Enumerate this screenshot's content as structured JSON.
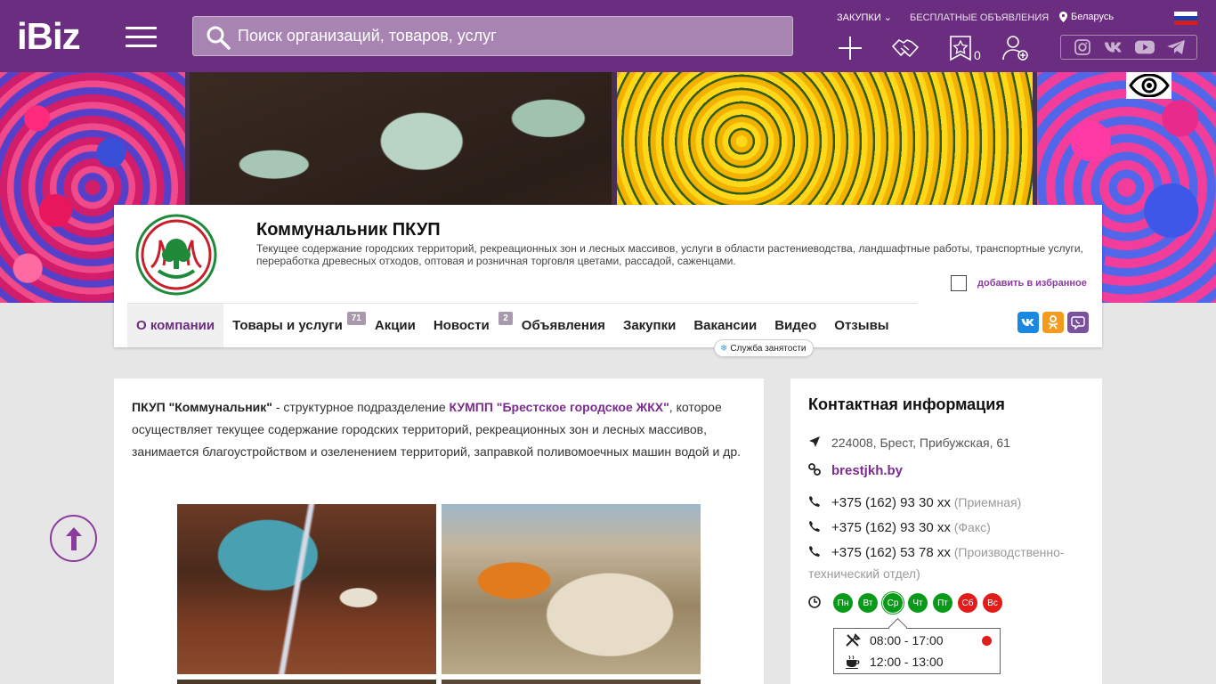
{
  "header": {
    "logo": "iBiz",
    "search_placeholder": "Поиск организаций, товаров, услуг",
    "links": [
      "ЗАКУПКИ",
      "БЕСПЛАТНЫЕ ОБЪЯВЛЕНИЯ"
    ],
    "region": "Беларусь",
    "favorites_count": "0"
  },
  "company": {
    "title": "Коммунальник ПКУП",
    "description": "Текущее содержание городских территорий, рекреационных зон и лесных массивов, услуги в области растениеводства, ландшафтные работы, транспортные услуги, переработка древесных отходов, оптовая и розничная торговля цветами, рассадой, саженцами.",
    "add_favorite": "добавить в избранное",
    "tabs": [
      {
        "label": "О компании",
        "badge": ""
      },
      {
        "label": "Товары и услуги",
        "badge": "71"
      },
      {
        "label": "Акции",
        "badge": ""
      },
      {
        "label": "Новости",
        "badge": "2"
      },
      {
        "label": "Объявления",
        "badge": ""
      },
      {
        "label": "Закупки",
        "badge": ""
      },
      {
        "label": "Вакансии",
        "badge": ""
      },
      {
        "label": "Видео",
        "badge": ""
      },
      {
        "label": "Отзывы",
        "badge": ""
      }
    ],
    "employment_tag": "Служба занятости"
  },
  "about": {
    "name_bold": "ПКУП \"Коммунальник\"",
    "text_1": " - структурное подразделение ",
    "link": "КУМПП \"Брестское городское ЖКХ\"",
    "text_2": ", которое осуществляет текущее содержание городских территорий, рекреационных зон и лесных массивов, занимается благоустройством и озеленением территорий, заправкой поливомоечных машин водой и др."
  },
  "contacts": {
    "title": "Контактная информация",
    "address": "224008, Брест, Прибужская, 61",
    "website": "brestjkh.by",
    "phones": [
      {
        "number": "+375 (162) 93 30 xx",
        "note": "(Приемная)"
      },
      {
        "number": "+375 (162) 93 30 xx",
        "note": "(Факс)"
      },
      {
        "number": "+375 (162) 53 78 xx",
        "note": "(Производственно-технический отдел)"
      }
    ],
    "days": [
      "Пн",
      "Вт",
      "Ср",
      "Чт",
      "Пт",
      "Сб",
      "Вс"
    ],
    "work_hours": "08:00 - 17:00",
    "break_hours": "12:00 - 13:00"
  },
  "colors": {
    "brand": "#6a2d7f",
    "work_day": "#0a9a1a",
    "holiday": "#e21b1b"
  }
}
